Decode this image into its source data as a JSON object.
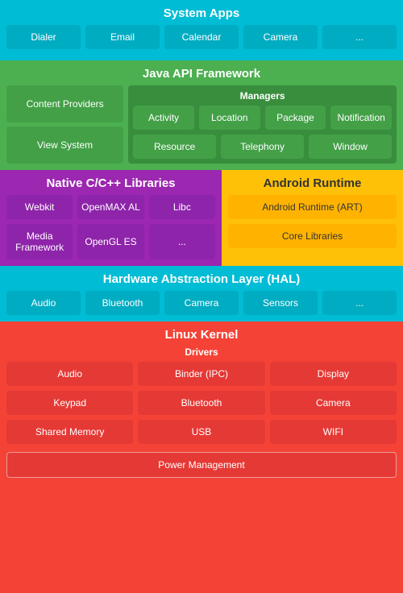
{
  "systemApps": {
    "title": "System Apps",
    "apps": [
      "Dialer",
      "Email",
      "Calendar",
      "Camera",
      "..."
    ]
  },
  "javaApi": {
    "title": "Java API Framework",
    "contentProviders": "Content Providers",
    "viewSystem": "View System",
    "managers": {
      "title": "Managers",
      "items": [
        "Activity",
        "Location",
        "Package",
        "Notification",
        "Resource",
        "Telephony",
        "Window"
      ]
    }
  },
  "nativeLibs": {
    "title": "Native C/C++ Libraries",
    "items": [
      "Webkit",
      "OpenMAX AL",
      "Libc",
      "Media Framework",
      "OpenGL ES",
      "..."
    ]
  },
  "androidRuntime": {
    "title": "Android Runtime",
    "items": [
      "Android Runtime (ART)",
      "Core Libraries"
    ]
  },
  "hal": {
    "title": "Hardware Abstraction Layer (HAL)",
    "items": [
      "Audio",
      "Bluetooth",
      "Camera",
      "Sensors",
      "..."
    ]
  },
  "kernel": {
    "title": "Linux Kernel",
    "driversTitle": "Drivers",
    "drivers": [
      "Audio",
      "Binder (IPC)",
      "Display",
      "Keypad",
      "Bluetooth",
      "Camera",
      "Shared Memory",
      "USB",
      "WIFI"
    ],
    "powerManagement": "Power Management"
  }
}
